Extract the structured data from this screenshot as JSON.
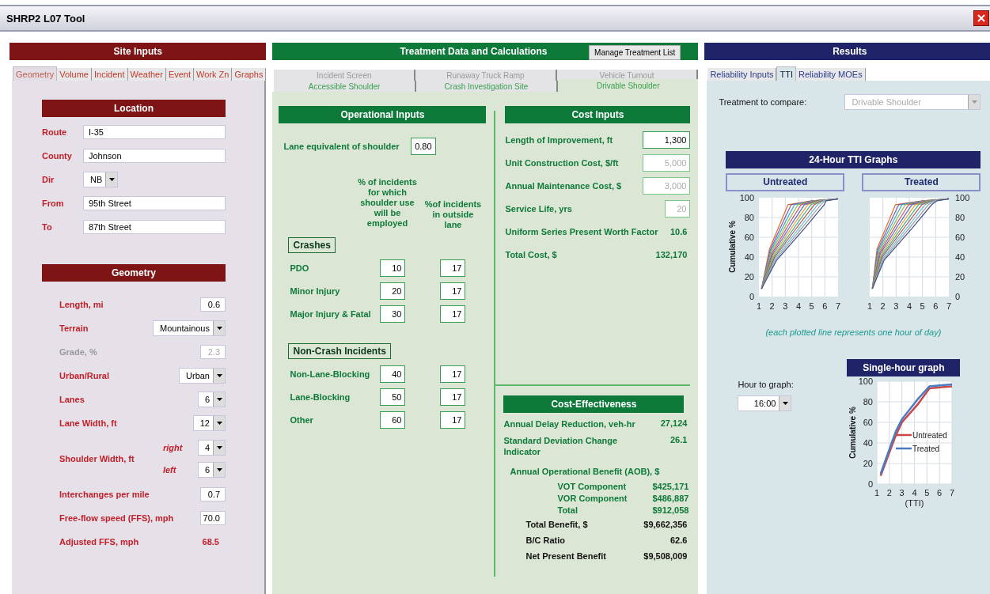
{
  "window": {
    "title": "SHRP2 L07 Tool"
  },
  "site_inputs": {
    "title": "Site Inputs",
    "tabs": [
      {
        "label": "Geometry",
        "selected": true
      },
      {
        "label": "Volume",
        "selected": false
      },
      {
        "label": "Incident",
        "selected": false
      },
      {
        "label": "Weather",
        "selected": false
      },
      {
        "label": "Event",
        "selected": false
      },
      {
        "label": "Work Zn",
        "selected": false
      },
      {
        "label": "Graphs",
        "selected": false
      }
    ],
    "location": {
      "title": "Location",
      "fields": [
        {
          "kind": "text",
          "label": "Route",
          "value": "I-35"
        },
        {
          "kind": "text",
          "label": "County",
          "value": "Johnson"
        },
        {
          "kind": "select",
          "label": "Dir",
          "value": "NB"
        },
        {
          "kind": "text",
          "label": "From",
          "value": "95th Street"
        },
        {
          "kind": "text",
          "label": "To",
          "value": "87th Street"
        }
      ]
    },
    "geometry": {
      "title": "Geometry",
      "rows": [
        {
          "kind": "input",
          "label": "Length, mi",
          "value": "0.6",
          "disabled": false
        },
        {
          "kind": "select",
          "label": "Terrain",
          "value": "Mountainous",
          "disabled": false
        },
        {
          "kind": "input",
          "label": "Grade, %",
          "value": "2.3",
          "disabled": true
        },
        {
          "kind": "select",
          "label": "Urban/Rural",
          "value": "Urban",
          "disabled": false
        },
        {
          "kind": "select",
          "label": "Lanes",
          "value": "6",
          "disabled": false
        },
        {
          "kind": "select",
          "label": "Lane Width, ft",
          "value": "12",
          "disabled": false
        },
        {
          "kind": "pair",
          "label": "Shoulder Width, ft",
          "disabled": false,
          "sides": [
            {
              "label": "right",
              "value": "4"
            },
            {
              "label": "left",
              "value": "6"
            }
          ]
        },
        {
          "kind": "input",
          "label": "Interchanges per mile",
          "value": "0.7",
          "disabled": false
        },
        {
          "kind": "input",
          "label": "Free-flow speed (FFS), mph",
          "value": "70.0",
          "disabled": false
        },
        {
          "kind": "readout",
          "label": "Adjusted FFS, mph",
          "value": "68.5",
          "disabled": false
        }
      ]
    }
  },
  "treatment": {
    "title": "Treatment Data and Calculations",
    "manage_button": "Manage Treatment List",
    "tabs_back": [
      {
        "label": "Incident Screen",
        "selected": false
      },
      {
        "label": "Runaway Truck Ramp",
        "selected": false
      },
      {
        "label": "Vehicle Turnout",
        "selected": false
      }
    ],
    "tabs_front": [
      {
        "label": "Accessible Shoulder",
        "selected": false
      },
      {
        "label": "Crash Investigation Site",
        "selected": false
      },
      {
        "label": "Drivable Shoulder",
        "selected": true
      }
    ],
    "operational": {
      "title": "Operational Inputs",
      "lane_equivalent": {
        "label": "Lane equivalent of shoulder",
        "value": "0.80"
      },
      "column_headers": [
        "% of incidents for which shoulder use will be employed",
        "%of incidents in outside lane"
      ],
      "groups": [
        {
          "title": "Crashes",
          "rows": [
            {
              "label": "PDO",
              "values": [
                "10",
                "17"
              ]
            },
            {
              "label": "Minor Injury",
              "values": [
                "20",
                "17"
              ]
            },
            {
              "label": "Major Injury & Fatal",
              "values": [
                "30",
                "17"
              ]
            }
          ]
        },
        {
          "title": "Non-Crash Incidents",
          "rows": [
            {
              "label": "Non-Lane-Blocking",
              "values": [
                "40",
                "17"
              ]
            },
            {
              "label": "Lane-Blocking",
              "values": [
                "50",
                "17"
              ]
            },
            {
              "label": "Other",
              "values": [
                "60",
                "17"
              ]
            }
          ]
        }
      ]
    },
    "cost_inputs": {
      "title": "Cost Inputs",
      "fields": [
        {
          "kind": "input",
          "label": "Length of Improvement, ft",
          "value": "1,300",
          "disabled": false
        },
        {
          "kind": "input",
          "label": "Unit Construction Cost, $/ft",
          "value": "5,000",
          "disabled": true
        },
        {
          "kind": "input",
          "label": "Annual Maintenance Cost, $",
          "value": "3,000",
          "disabled": true
        },
        {
          "kind": "short",
          "label": "Service Life, yrs",
          "value": "20",
          "disabled": true
        },
        {
          "kind": "readout",
          "label": "Uniform Series Present Worth Factor",
          "value": "10.6"
        },
        {
          "kind": "readout",
          "label": "Total Cost, $",
          "value": "132,170"
        }
      ]
    },
    "cost_effectiveness": {
      "title": "Cost-Effectiveness",
      "rows": [
        {
          "label": "Annual Delay Reduction, veh-hr",
          "value": "27,124"
        },
        {
          "label": "Standard Deviation Change Indicator",
          "value": "26.1"
        }
      ],
      "aob": {
        "title": "Annual Operational Benefit (AOB), $",
        "rows": [
          {
            "label": "VOT Component",
            "value": "$425,171"
          },
          {
            "label": "VOR Component",
            "value": "$486,887"
          },
          {
            "label": "Total",
            "value": "$912,058"
          }
        ]
      },
      "totals": [
        {
          "label": "Total Benefit, $",
          "value": "$9,662,356"
        },
        {
          "label": "B/C Ratio",
          "value": "62.6"
        },
        {
          "label": "Net Present Benefit",
          "value": "$9,508,009"
        }
      ]
    }
  },
  "results": {
    "title": "Results",
    "tabs": [
      {
        "label": "Reliability Inputs",
        "selected": false
      },
      {
        "label": "TTI",
        "selected": true
      },
      {
        "label": "Reliability MOEs",
        "selected": false
      }
    ],
    "compare": {
      "label": "Treatment to compare:",
      "value": "Drivable Shoulder",
      "disabled": true
    },
    "tti_graphs": {
      "title": "24-Hour TTI Graphs",
      "panels": [
        {
          "title": "Untreated",
          "ylabel": "Cumulative %",
          "yticks": [
            "100",
            "80",
            "60",
            "40",
            "20",
            "0"
          ],
          "xticks": [
            "1",
            "2",
            "3",
            "4",
            "5",
            "6",
            "7"
          ]
        },
        {
          "title": "Treated",
          "yticks": [
            "100",
            "80",
            "60",
            "40",
            "20",
            "0"
          ],
          "xticks": [
            "1",
            "2",
            "3",
            "4",
            "5",
            "6",
            "7"
          ]
        }
      ],
      "note": "(each plotted line represents one hour of day)"
    },
    "single_hour": {
      "hour_label": "Hour to graph:",
      "hour_value": "16:00",
      "chart_data": {
        "type": "line",
        "title": "Single-hour graph",
        "xlabel": "(TTI)",
        "ylabel": "Cumulative %",
        "x": [
          1.3,
          2.5,
          3,
          4.3,
          5.2,
          6,
          7
        ],
        "series": [
          {
            "name": "Untreated",
            "color": "#c8484a",
            "values": [
              8,
              47,
              60,
              78,
              93,
              94,
              95
            ]
          },
          {
            "name": "Treated",
            "color": "#4a7cc4",
            "values": [
              10,
              51,
              63,
              83,
              95,
              96,
              97
            ]
          }
        ],
        "xlim": [
          1,
          7
        ],
        "ylim": [
          0,
          100
        ],
        "xticks": [
          1,
          2,
          3,
          4,
          5,
          6,
          7
        ],
        "yticks": [
          100,
          80,
          60,
          40,
          20,
          0
        ],
        "grid": true,
        "legend": true
      }
    }
  }
}
